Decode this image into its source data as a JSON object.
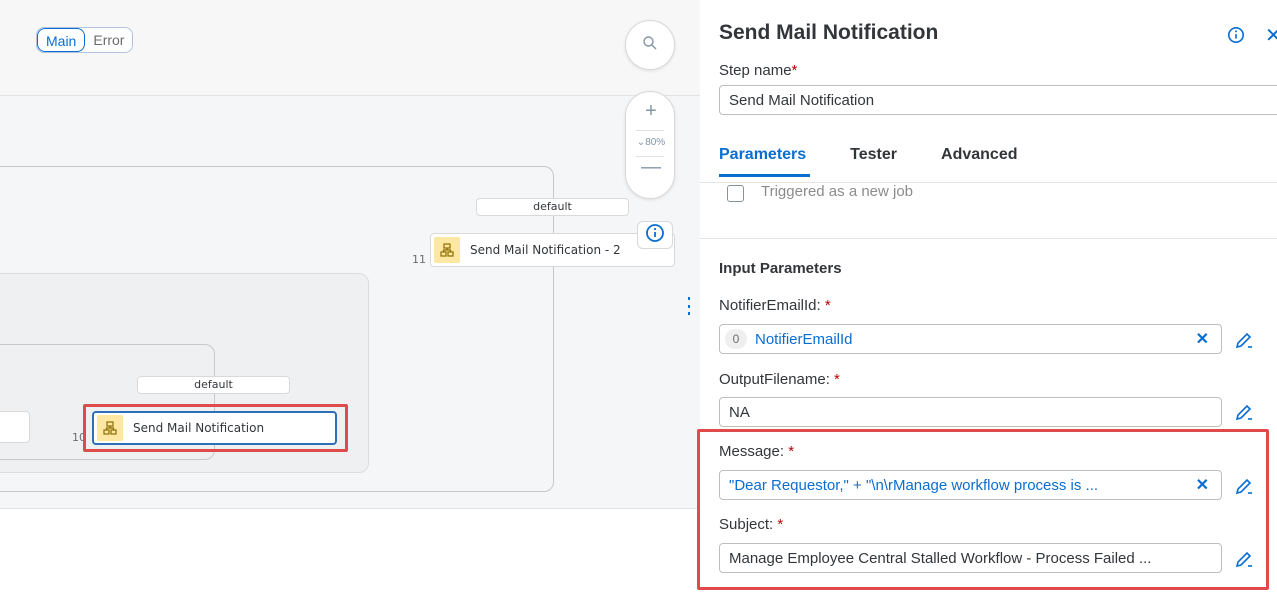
{
  "canvas": {
    "segment": {
      "main_label": "Main",
      "error_label": "Error"
    },
    "zoom": {
      "level": "80%"
    },
    "nodes": [
      {
        "number": "11",
        "label": "Send Mail Notification - 2",
        "branch": "default"
      },
      {
        "number": "10",
        "label": "Send Mail Notification",
        "branch": "default"
      }
    ]
  },
  "panel": {
    "title": "Send Mail Notification",
    "step_name_label": "Step name",
    "step_name_value": "Send Mail Notification",
    "tabs": [
      {
        "label": "Parameters",
        "active": true
      },
      {
        "label": "Tester",
        "active": false
      },
      {
        "label": "Advanced",
        "active": false
      }
    ],
    "triggered_label": "Triggered as a new job",
    "section_title": "Input Parameters",
    "params": [
      {
        "label": "NotifierEmailId:",
        "token_badge": "0",
        "value": "NotifierEmailId"
      },
      {
        "label": "OutputFilename:",
        "value": "NA"
      },
      {
        "label": "Message:",
        "value": "\"Dear Requestor,\" + \"\\n\\rManage workflow process is ..."
      },
      {
        "label": "Subject:",
        "value": "Manage Employee Central Stalled Workflow - Process Failed ..."
      }
    ],
    "required_mark": "*"
  },
  "colors": {
    "accent": "#0a6ed1",
    "highlight": "#e04a4a",
    "required": "#bb0000",
    "node_icon_bg": "#fde7a2"
  }
}
